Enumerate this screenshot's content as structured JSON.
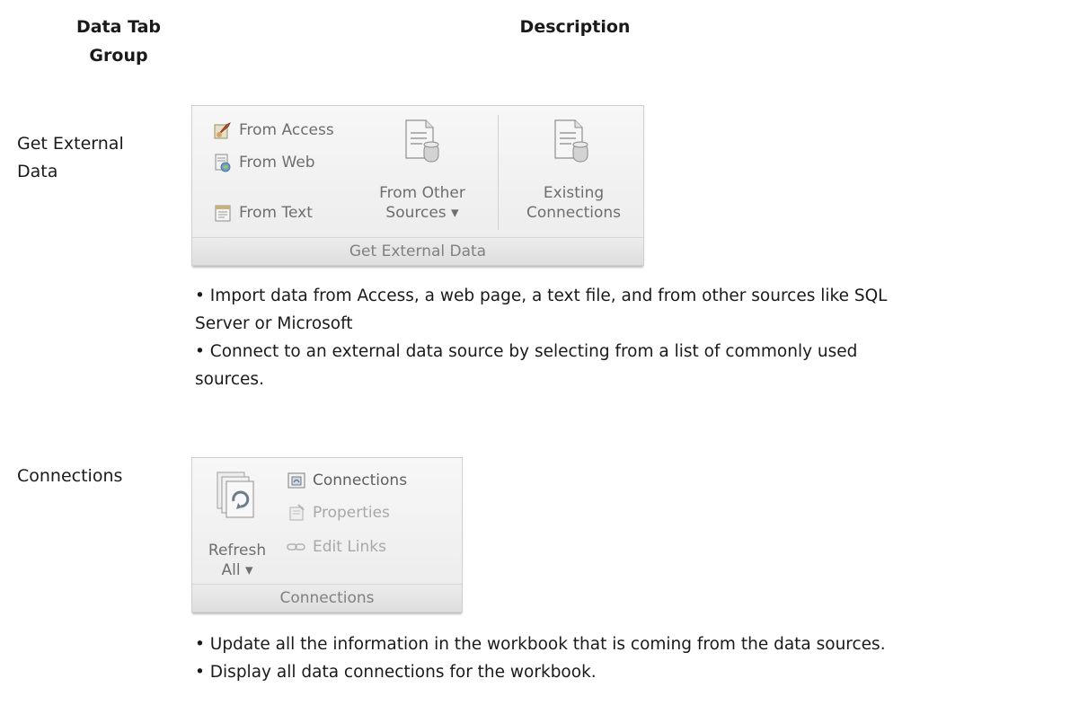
{
  "header": {
    "group_col": "Data Tab\nGroup",
    "group_line1": "Data Tab",
    "group_line2": "Group",
    "description_col": "Description"
  },
  "rows": [
    {
      "label_line1": "Get External",
      "label_line2": "Data",
      "ribbon": {
        "from_access": "From Access",
        "from_web": "From Web",
        "from_text": "From Text",
        "from_other_line1": "From Other",
        "from_other_line2": "Sources ▾",
        "existing_line1": "Existing",
        "existing_line2": "Connections",
        "footer": "Get External Data"
      },
      "bullets": [
        "• Import data from Access, a web page, a text file, and from other sources like SQL",
        "Server or Microsoft",
        "• Connect to an external data source by selecting from a list of commonly used",
        "sources."
      ]
    },
    {
      "label_line1": "Connections",
      "ribbon": {
        "refresh_line1": "Refresh",
        "refresh_line2": "All ▾",
        "connections": "Connections",
        "properties": "Properties",
        "edit_links": "Edit Links",
        "footer": "Connections"
      },
      "bullets": [
        "• Update all the information in the workbook that is coming from the data sources.",
        "• Display all data connections for the workbook."
      ]
    }
  ],
  "icons": {
    "access": "access-db-icon",
    "web": "web-page-icon",
    "text": "text-file-icon",
    "other_sources": "database-sheet-icon",
    "existing_connections": "connection-sheet-icon",
    "refresh": "refresh-icon",
    "connections": "connections-icon",
    "properties": "properties-icon",
    "edit_links": "chain-link-icon"
  }
}
